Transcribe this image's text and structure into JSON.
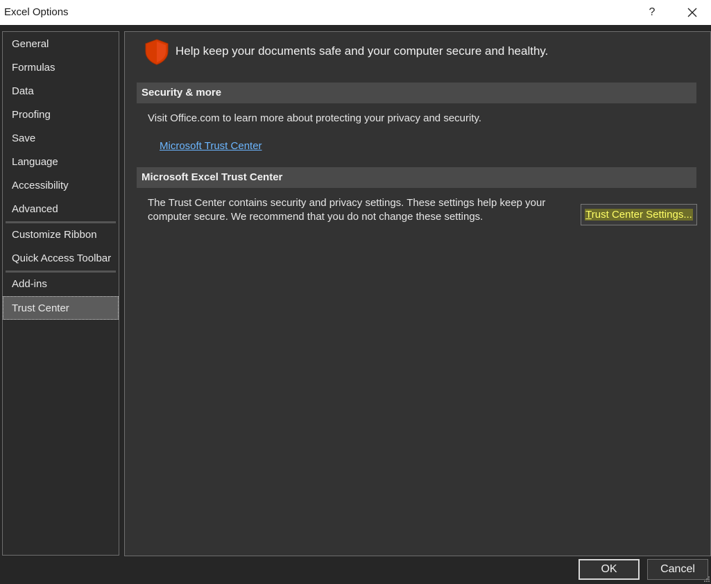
{
  "window": {
    "title": "Excel Options",
    "help_label": "?",
    "close_icon": "close-icon"
  },
  "sidebar": {
    "items": [
      {
        "label": "General"
      },
      {
        "label": "Formulas"
      },
      {
        "label": "Data"
      },
      {
        "label": "Proofing"
      },
      {
        "label": "Save"
      },
      {
        "label": "Language"
      },
      {
        "label": "Accessibility"
      },
      {
        "label": "Advanced"
      },
      {
        "label": "Customize Ribbon"
      },
      {
        "label": "Quick Access Toolbar"
      },
      {
        "label": "Add-ins"
      },
      {
        "label": "Trust Center"
      }
    ],
    "selected": "Trust Center"
  },
  "main": {
    "intro": "Help keep your documents safe and your computer secure and healthy.",
    "security_section": {
      "heading": "Security & more",
      "text": "Visit Office.com to learn more about protecting your privacy and security.",
      "link": "Microsoft Trust Center"
    },
    "trust_section": {
      "heading": "Microsoft Excel Trust Center",
      "text_line1": "The Trust Center contains security and privacy settings. These settings help keep your",
      "text_line2": "computer secure. We recommend that you do not change these settings.",
      "button_access_key": "T",
      "button_rest": "rust Center Settings..."
    }
  },
  "footer": {
    "ok_label": "OK",
    "cancel_label": "Cancel"
  },
  "colors": {
    "background": "#262626",
    "panel": "#333333",
    "section_header": "#4a4a4a",
    "link": "#6cb6ff",
    "shield": "#d83b01",
    "highlight_text": "#ffff66"
  }
}
